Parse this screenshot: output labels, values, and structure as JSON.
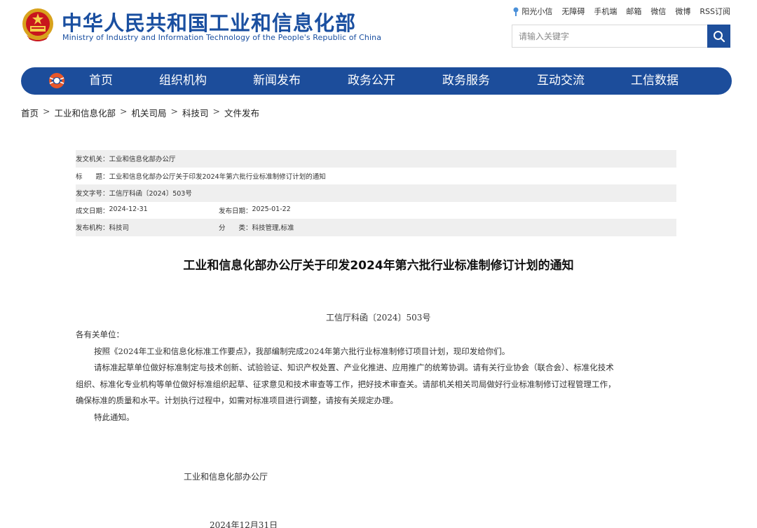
{
  "header": {
    "site_title": "中华人民共和国工业和信息化部",
    "site_subtitle": "Ministry of Industry and Information Technology of the People's Republic of China",
    "top_links": [
      "阳光小信",
      "无障碍",
      "手机端",
      "邮箱",
      "微信",
      "微博",
      "RSS订阅"
    ],
    "search_placeholder": "请输入关键字",
    "brand_color": "#1c4d9b"
  },
  "nav": {
    "items": [
      "首页",
      "组织机构",
      "新闻发布",
      "政务公开",
      "政务服务",
      "互动交流",
      "工信数据"
    ]
  },
  "breadcrumb": [
    "首页",
    "工业和信息化部",
    "机关司局",
    "科技司",
    "文件发布"
  ],
  "meta": {
    "issuer_label": "发文机关：",
    "issuer": "工业和信息化部办公厅",
    "title_label": "标　　题：",
    "title": "工业和信息化部办公厅关于印发2024年第六批行业标准制修订计划的通知",
    "docno_label": "发文字号：",
    "docno": "工信厅科函〔2024〕503号",
    "date_label": "成文日期：",
    "date": "2024-12-31",
    "pubdate_label": "发布日期：",
    "pubdate": "2025-01-22",
    "org_label": "发布机构：",
    "org": "科技司",
    "category_label": "分　　类：",
    "category": "科技管理,标准"
  },
  "article": {
    "title": "工业和信息化部办公厅关于印发2024年第六批行业标准制修订计划的通知",
    "doc_no": "工信厅科函〔2024〕503号",
    "salutation": "各有关单位：",
    "para1": "按照《2024年工业和信息化标准工作要点》，我部编制完成2024年第六批行业标准制修订项目计划，现印发给你们。",
    "para2_line1": "请标准起草单位做好标准制定与技术创新、试验验证、知识产权处置、产业化推进、应用推广的统筹协调。请有关行业协会（联合会）、标准化技术",
    "para2_line2": "组织、标准化专业机构等单位做好标准组织起草、征求意见和技术审查等工作，把好技术审查关。请部机关相关司局做好行业标准制修订过程管理工作，",
    "para2_line3": "确保标准的质量和水平。计划执行过程中，如需对标准项目进行调整，请按有关规定办理。",
    "closing": "特此通知。",
    "signer": "工业和信息化部办公厅",
    "sign_date": "2024年12月31日"
  }
}
